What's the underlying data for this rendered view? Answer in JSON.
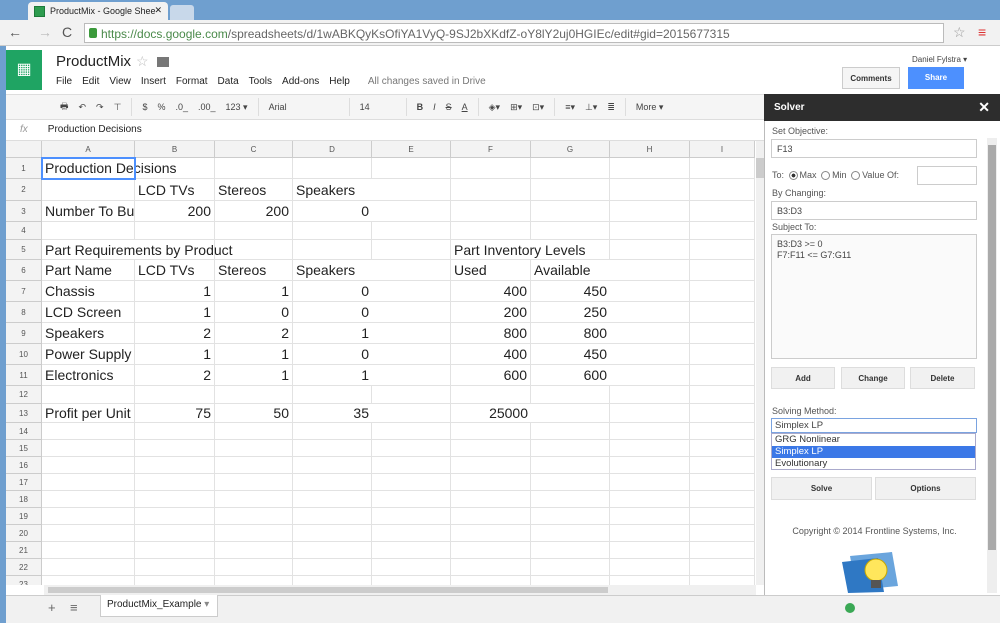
{
  "browser": {
    "tab_title": "ProductMix - Google Shee",
    "url_host": "https://docs.google.com",
    "url_path": "/spreadsheets/d/1wABKQyKsOfiYA1VyQ-9SJ2bXKdfZ-oY8lY2uj0HGIEc/edit#gid=2015677315"
  },
  "doc": {
    "title": "ProductMix",
    "menu": [
      "File",
      "Edit",
      "View",
      "Insert",
      "Format",
      "Data",
      "Tools",
      "Add-ons",
      "Help"
    ],
    "saved_status": "All changes saved in Drive",
    "user": "Daniel Fylstra ▾",
    "comments_label": "Comments",
    "share_label": "Share"
  },
  "toolbar": {
    "currency": "$",
    "percent": "%",
    "dec_less": ".0_",
    "dec_more": ".00_",
    "format": "123 ▾",
    "font": "Arial",
    "font_size": "14",
    "bold": "B",
    "italic": "I",
    "strike": "S",
    "text_color": "A",
    "more": "More ▾"
  },
  "formula_bar": {
    "fx": "fx",
    "value": "Production Decisions"
  },
  "grid": {
    "columns": [
      "A",
      "B",
      "C",
      "D",
      "E",
      "F",
      "G",
      "H",
      "I"
    ],
    "rows": [
      "1",
      "2",
      "3",
      "4",
      "5",
      "6",
      "7",
      "8",
      "9",
      "10",
      "11",
      "12",
      "13",
      "14",
      "15",
      "16",
      "17",
      "18",
      "19",
      "20",
      "21",
      "22",
      "23"
    ],
    "cells": [
      {
        "ref": "A1",
        "text": "Production Decisions"
      },
      {
        "ref": "B2",
        "text": "LCD TVs"
      },
      {
        "ref": "C2",
        "text": "Stereos"
      },
      {
        "ref": "D2",
        "text": "Speakers"
      },
      {
        "ref": "A3",
        "text": "Number To Build"
      },
      {
        "ref": "B3",
        "text": "200",
        "num": true
      },
      {
        "ref": "C3",
        "text": "200",
        "num": true
      },
      {
        "ref": "D3",
        "text": "0",
        "num": true
      },
      {
        "ref": "A5",
        "text": "Part Requirements by Product"
      },
      {
        "ref": "F5",
        "text": "Part Inventory Levels"
      },
      {
        "ref": "A6",
        "text": "Part Name"
      },
      {
        "ref": "B6",
        "text": "LCD TVs"
      },
      {
        "ref": "C6",
        "text": "Stereos"
      },
      {
        "ref": "D6",
        "text": "Speakers"
      },
      {
        "ref": "F6",
        "text": "Used"
      },
      {
        "ref": "G6",
        "text": "Available"
      },
      {
        "ref": "A7",
        "text": "Chassis"
      },
      {
        "ref": "B7",
        "text": "1",
        "num": true
      },
      {
        "ref": "C7",
        "text": "1",
        "num": true
      },
      {
        "ref": "D7",
        "text": "0",
        "num": true
      },
      {
        "ref": "F7",
        "text": "400",
        "num": true
      },
      {
        "ref": "G7",
        "text": "450",
        "num": true
      },
      {
        "ref": "A8",
        "text": "LCD Screen"
      },
      {
        "ref": "B8",
        "text": "1",
        "num": true
      },
      {
        "ref": "C8",
        "text": "0",
        "num": true
      },
      {
        "ref": "D8",
        "text": "0",
        "num": true
      },
      {
        "ref": "F8",
        "text": "200",
        "num": true
      },
      {
        "ref": "G8",
        "text": "250",
        "num": true
      },
      {
        "ref": "A9",
        "text": "Speakers"
      },
      {
        "ref": "B9",
        "text": "2",
        "num": true
      },
      {
        "ref": "C9",
        "text": "2",
        "num": true
      },
      {
        "ref": "D9",
        "text": "1",
        "num": true
      },
      {
        "ref": "F9",
        "text": "800",
        "num": true
      },
      {
        "ref": "G9",
        "text": "800",
        "num": true
      },
      {
        "ref": "A10",
        "text": "Power Supply"
      },
      {
        "ref": "B10",
        "text": "1",
        "num": true
      },
      {
        "ref": "C10",
        "text": "1",
        "num": true
      },
      {
        "ref": "D10",
        "text": "0",
        "num": true
      },
      {
        "ref": "F10",
        "text": "400",
        "num": true
      },
      {
        "ref": "G10",
        "text": "450",
        "num": true
      },
      {
        "ref": "A11",
        "text": "Electronics"
      },
      {
        "ref": "B11",
        "text": "2",
        "num": true
      },
      {
        "ref": "C11",
        "text": "1",
        "num": true
      },
      {
        "ref": "D11",
        "text": "1",
        "num": true
      },
      {
        "ref": "F11",
        "text": "600",
        "num": true
      },
      {
        "ref": "G11",
        "text": "600",
        "num": true
      },
      {
        "ref": "A13",
        "text": "Profit per Unit"
      },
      {
        "ref": "B13",
        "text": "75",
        "num": true
      },
      {
        "ref": "C13",
        "text": "50",
        "num": true
      },
      {
        "ref": "D13",
        "text": "35",
        "num": true
      },
      {
        "ref": "F13",
        "text": "25000",
        "num": true
      }
    ],
    "selected": "A1"
  },
  "sheets": {
    "active": "ProductMix_Example"
  },
  "solver": {
    "title": "Solver",
    "close": "✕",
    "objective_label": "Set Objective:",
    "objective": "F13",
    "to_label": "To:",
    "max": "Max",
    "min": "Min",
    "value_of": "Value Of:",
    "selected_goal": "Max",
    "changing_label": "By Changing:",
    "changing": "B3:D3",
    "subject_label": "Subject To:",
    "constraints": [
      "B3:D3 >= 0",
      "F7:F11 <= G7:G11"
    ],
    "add": "Add",
    "change": "Change",
    "delete": "Delete",
    "method_label": "Solving Method:",
    "method": "Simplex LP",
    "method_options": [
      "GRG Nonlinear",
      "Simplex LP",
      "Evolutionary"
    ],
    "solve": "Solve",
    "options": "Options",
    "copyright": "Copyright © 2014 Frontline Systems, Inc."
  }
}
